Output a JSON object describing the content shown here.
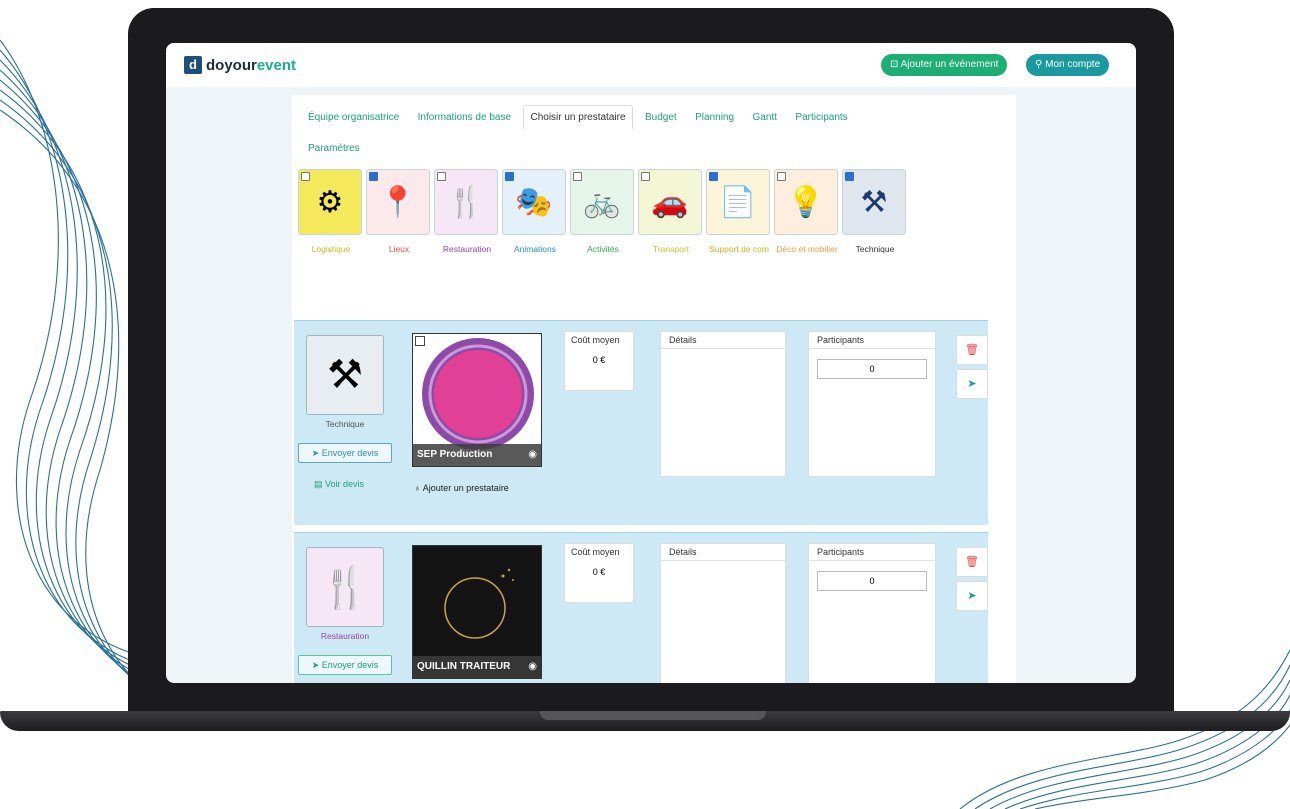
{
  "app": {
    "logo_letter": "d",
    "logo_text_dark": "doyour",
    "logo_text_accent": "event",
    "add_event_label": "Ajouter un événement",
    "account_label": "Mon compte"
  },
  "tabs": [
    {
      "label": "Équipe organisatrice"
    },
    {
      "label": "Informations de base"
    },
    {
      "label": "Choisir un prestataire"
    },
    {
      "label": "Budget"
    },
    {
      "label": "Planning"
    },
    {
      "label": "Gantt"
    },
    {
      "label": "Participants"
    }
  ],
  "tab_settings": "Paramètres",
  "categories": [
    {
      "label": "Logistique",
      "icon": "people-gear-icon",
      "color": "#e8d92e",
      "checked": false
    },
    {
      "label": "Lieux",
      "icon": "map-pin-icon",
      "color": "#e24a4a",
      "checked": true
    },
    {
      "label": "Restauration",
      "icon": "cutlery-icon",
      "color": "#9b3fae",
      "checked": false
    },
    {
      "label": "Animations",
      "icon": "masks-icon",
      "color": "#1f8fd1",
      "checked": true
    },
    {
      "label": "Activités",
      "icon": "bicycle-icon",
      "color": "#2fa84f",
      "checked": false
    },
    {
      "label": "Transport",
      "icon": "car-icon",
      "color": "#c7d63a",
      "checked": false
    },
    {
      "label": "Support de com",
      "icon": "documents-icon",
      "color": "#e8c224",
      "checked": true
    },
    {
      "label": "Déco et mobilier",
      "icon": "lamp-icon",
      "color": "#f29a3b",
      "checked": false
    },
    {
      "label": "Technique",
      "icon": "tools-icon",
      "color": "#1b3b6f",
      "checked": true
    }
  ],
  "rows": [
    {
      "service_label": "Technique",
      "service_icon": "tools-icon",
      "send_quote": "Envoyer devis",
      "view_quote": "Voir devis",
      "provider_name": "SEP Production",
      "add_provider": "Ajouter un prestataire",
      "cost_label": "Coût moyen",
      "cost_value": "0 €",
      "details_label": "Détails",
      "participants_label": "Participants",
      "participants_value": "0"
    },
    {
      "service_label": "Restauration",
      "service_icon": "cutlery-icon",
      "send_quote": "Envoyer devis",
      "provider_name": "QUILLIN TRAITEUR",
      "cost_label": "Coût moyen",
      "cost_value": "0 €",
      "details_label": "Détails",
      "participants_label": "Participants",
      "participants_value": "0"
    }
  ],
  "colors": {
    "accent_green": "#1cae74",
    "accent_teal": "#1a9aa0",
    "row_bg": "#cde9f5"
  }
}
